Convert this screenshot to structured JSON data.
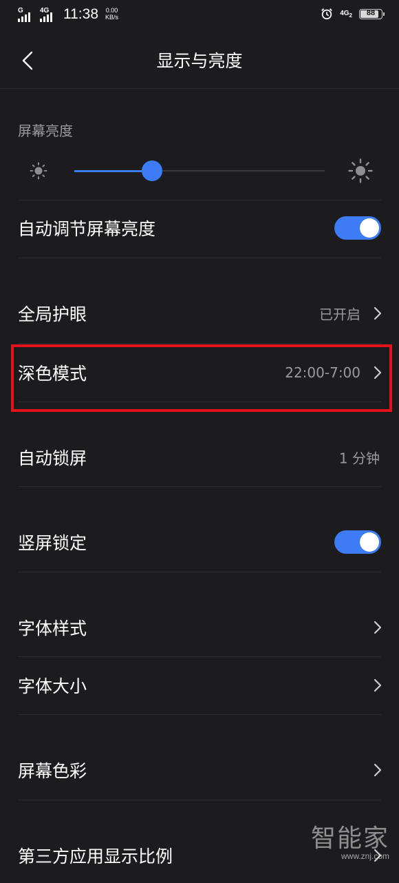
{
  "status_bar": {
    "signal_1_tag": "G",
    "signal_2_tag": "4G",
    "time": "11:38",
    "net_speed_value": "0.00",
    "net_speed_unit": "KB/s",
    "network_type": "4G",
    "network_sub": "2",
    "battery_level": "88",
    "battery_fraction": 0.88
  },
  "header": {
    "title": "显示与亮度"
  },
  "brightness": {
    "section_label": "屏幕亮度",
    "level_fraction": 0.31
  },
  "settings": {
    "auto_brightness": {
      "label": "自动调节屏幕亮度",
      "enabled": true
    },
    "eye_protection": {
      "label": "全局护眼",
      "value": "已开启"
    },
    "dark_mode": {
      "label": "深色模式",
      "value": "22:00-7:00"
    },
    "auto_lock": {
      "label": "自动锁屏",
      "value": "1 分钟"
    },
    "rotation_lock": {
      "label": "竖屏锁定",
      "enabled": true
    },
    "font_style": {
      "label": "字体样式"
    },
    "font_size": {
      "label": "字体大小"
    },
    "screen_color": {
      "label": "屏幕色彩"
    },
    "third_party_ratio": {
      "label": "第三方应用显示比例"
    }
  },
  "watermark": {
    "logo": "智能家",
    "url": "www.znj.com"
  },
  "colors": {
    "background": "#1c1c1e",
    "accent": "#3d7cf6",
    "highlight": "#e3121b",
    "secondary_text": "#9a9a9f"
  },
  "icons": [
    "signal-icon",
    "alarm-icon",
    "battery-icon",
    "back-arrow-icon",
    "sun-small-icon",
    "sun-large-icon",
    "chevron-right-icon"
  ]
}
